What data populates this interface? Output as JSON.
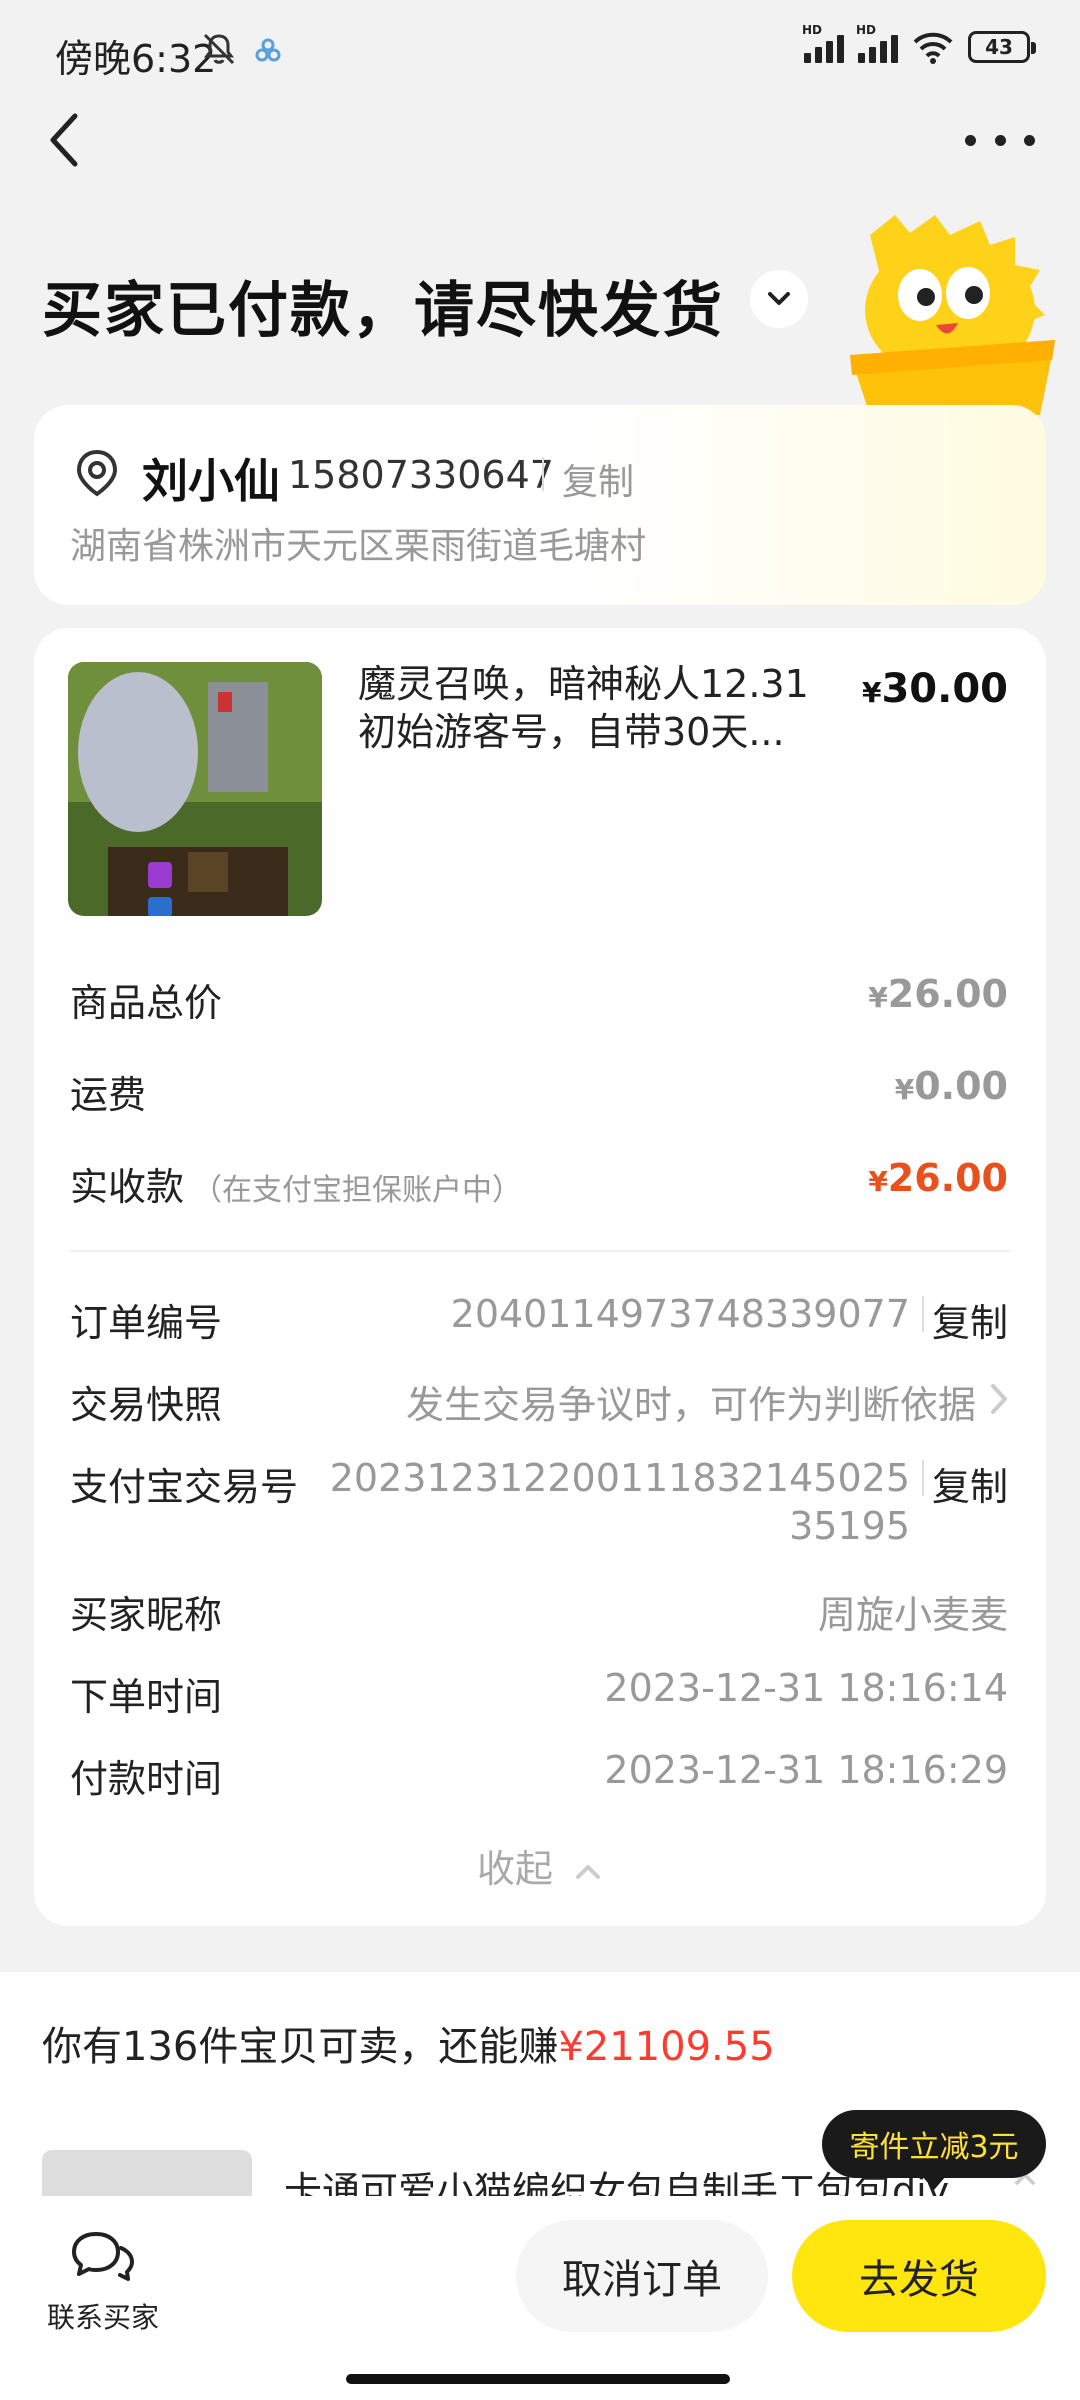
{
  "status_bar": {
    "time": "傍晚6:32",
    "network_1": "HD",
    "network_2": "HD",
    "battery": "43"
  },
  "header": {
    "title": "买家已付款，请尽快发货"
  },
  "address": {
    "name": "刘小仙",
    "phone": "15807330647",
    "copy_label": "复制",
    "detail": "湖南省株洲市天元区栗雨街道毛塘村"
  },
  "product": {
    "title": "魔灵召唤，暗神秘人12.31初始游客号，自带30天...",
    "price_symbol": "¥",
    "price": "30.00"
  },
  "summary": {
    "subtotal_label": "商品总价",
    "subtotal_symbol": "¥",
    "subtotal": "26.00",
    "shipping_label": "运费",
    "shipping_symbol": "¥",
    "shipping": "0.00",
    "received_label": "实收款",
    "received_note": "（在支付宝担保账户中）",
    "received_symbol": "¥",
    "received": "26.00"
  },
  "details": {
    "order_no_label": "订单编号",
    "order_no": "2040114973748339077",
    "copy_label": "复制",
    "snapshot_label": "交易快照",
    "snapshot_value": "发生交易争议时，可作为判断依据",
    "alipay_label": "支付宝交易号",
    "alipay_line1": "202312312200111832145025",
    "alipay_line2": "35195",
    "alipay_copy_label": "复制",
    "buyer_label": "买家昵称",
    "buyer": "周旋小麦麦",
    "order_time_label": "下单时间",
    "order_time": "2023-12-31 18:16:14",
    "pay_time_label": "付款时间",
    "pay_time": "2023-12-31 18:16:29",
    "collapse_label": "收起"
  },
  "promo": {
    "text": "你有136件宝贝可卖，还能赚",
    "amount": "¥21109.55",
    "item_title": "卡通可爱小猫编织女包自制手工包包diy...",
    "bubble": "寄件立减3元"
  },
  "actions": {
    "contact_label": "联系买家",
    "cancel_label": "取消订单",
    "ship_label": "去发货"
  },
  "colors": {
    "accent_yellow": "#ffe60f",
    "price_red": "#e8501c",
    "promo_red": "#ff3b30"
  }
}
